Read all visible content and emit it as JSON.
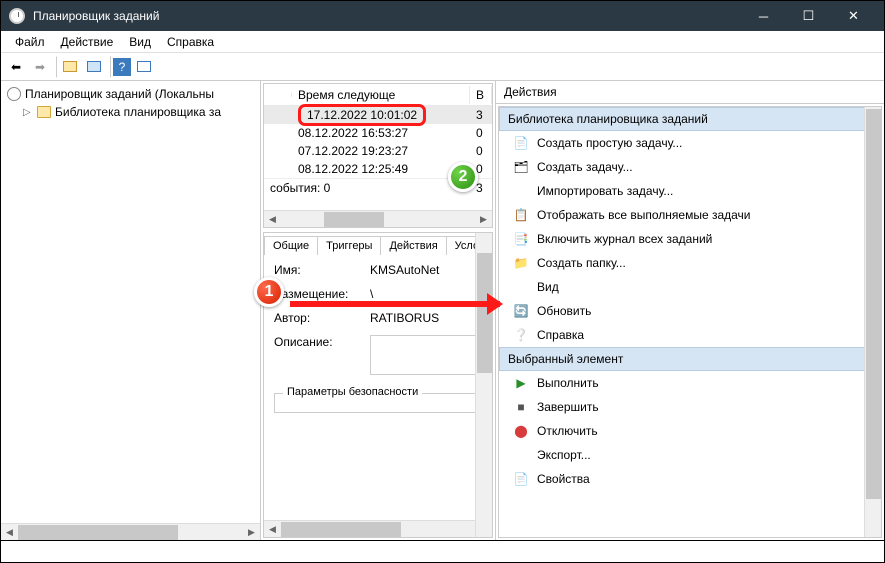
{
  "window": {
    "title": "Планировщик заданий"
  },
  "menu": {
    "file": "Файл",
    "action": "Действие",
    "view": "Вид",
    "help": "Справка"
  },
  "tree": {
    "root": "Планировщик заданий (Локальны",
    "child": "Библиотека планировщика за"
  },
  "tasklist": {
    "header_time": "Время следующе",
    "header_b": "В",
    "rows": [
      {
        "time": "17.12.2022 10:01:02",
        "b": "3"
      },
      {
        "time": "08.12.2022 16:53:27",
        "b": "0"
      },
      {
        "time": "07.12.2022 19:23:27",
        "b": "0"
      },
      {
        "time": "08.12.2022 12:25:49",
        "b": "0"
      }
    ],
    "events": "события: 0",
    "events_b": "3"
  },
  "tabs": {
    "general": "Общие",
    "triggers": "Триггеры",
    "actions": "Действия",
    "conditions": "Услови"
  },
  "form": {
    "name_lbl": "Имя:",
    "name_val": "KMSAutoNet",
    "loc_lbl": "Размещение:",
    "loc_val": "\\",
    "author_lbl": "Автор:",
    "author_val": "RATIBORUS",
    "desc_lbl": "Описание:",
    "sec": "Параметры безопасности"
  },
  "actions": {
    "title": "Действия",
    "section1": "Библиотека планировщика заданий",
    "items1": [
      {
        "icon": "📄",
        "label": "Создать простую задачу..."
      },
      {
        "icon": "🗂",
        "label": "Создать задачу..."
      },
      {
        "icon": "",
        "label": "Импортировать задачу..."
      },
      {
        "icon": "📋",
        "label": "Отображать все выполняемые задачи"
      },
      {
        "icon": "📑",
        "label": "Включить журнал всех заданий"
      },
      {
        "icon": "📁",
        "label": "Создать папку..."
      },
      {
        "icon": "",
        "label": "Вид",
        "arrow": true
      },
      {
        "icon": "🔄",
        "label": "Обновить"
      },
      {
        "icon": "❔",
        "label": "Справка"
      }
    ],
    "section2": "Выбранный элемент",
    "items2": [
      {
        "icon": "▶",
        "color": "#2a8f2a",
        "label": "Выполнить"
      },
      {
        "icon": "■",
        "color": "#555",
        "label": "Завершить"
      },
      {
        "icon": "⬤",
        "color": "#d83b3b",
        "label": "Отключить"
      },
      {
        "icon": "",
        "label": "Экспорт..."
      },
      {
        "icon": "📄",
        "label": "Свойства"
      }
    ]
  }
}
